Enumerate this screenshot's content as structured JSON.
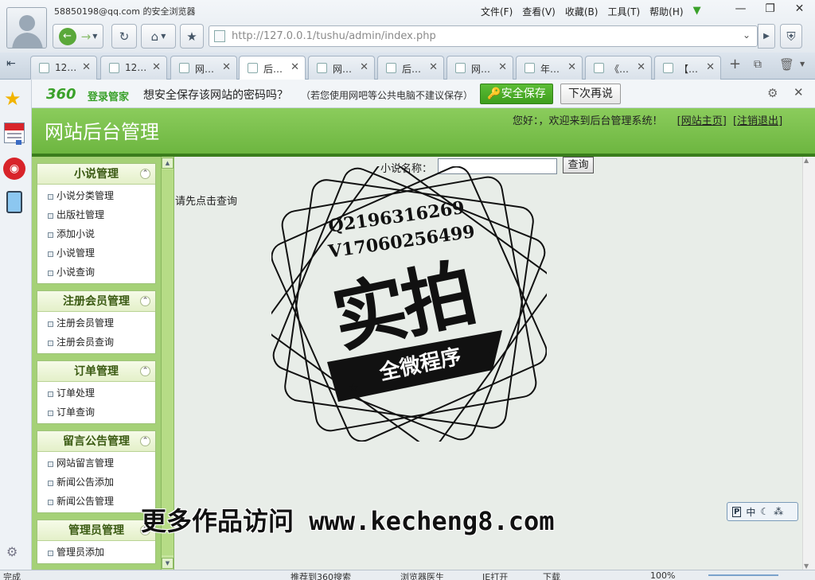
{
  "browser": {
    "account": "58850198@qq.com 的安全浏览器",
    "menus": [
      "文件(F)",
      "查看(V)",
      "收藏(B)",
      "工具(T)",
      "帮助(H)"
    ],
    "url": "http://127.0.0.1/tushu/admin/index.php",
    "tabs": [
      "12…",
      "12…",
      "网…",
      "后…",
      "网…",
      "后…",
      "网…",
      "年…",
      "《…",
      "【…"
    ],
    "active_tab": 3
  },
  "password_bar": {
    "brand": "360",
    "brand_suffix": "登录管家",
    "prompt": "想安全保存该网站的密码吗？",
    "note": "（若您使用网吧等公共电脑不建议保存）",
    "save_label": "安全保存",
    "later_label": "下次再说"
  },
  "header": {
    "title": "网站后台管理",
    "welcome": "您好：，欢迎来到后台管理系统！",
    "home_link": "网站主页",
    "logout_link": "注销退出"
  },
  "menu": [
    {
      "title": "小说管理",
      "items": [
        "小说分类管理",
        "出版社管理",
        "添加小说",
        "小说管理",
        "小说查询"
      ]
    },
    {
      "title": "注册会员管理",
      "items": [
        "注册会员管理",
        "注册会员查询"
      ]
    },
    {
      "title": "订单管理",
      "items": [
        "订单处理",
        "订单查询"
      ]
    },
    {
      "title": "留言公告管理",
      "items": [
        "网站留言管理",
        "新闻公告添加",
        "新闻公告管理"
      ]
    },
    {
      "title": "管理员管理",
      "items": [
        "管理员添加"
      ]
    }
  ],
  "search": {
    "label": "小说名称：",
    "value": "",
    "button": "查询"
  },
  "hint": "请先点击查询",
  "stamp": {
    "line1": "Q2196316269",
    "line2": "V17060256499",
    "big": "实拍",
    "ribbon": "全微程序"
  },
  "watermark": "更多作品访问 www.kecheng8.com",
  "ime": [
    "中"
  ],
  "status": {
    "left": "完成",
    "items": [
      "推荐到360搜索",
      "浏览器医生",
      "IE打开",
      "下载",
      "100%"
    ]
  },
  "colors": {
    "header_green": "#6db640",
    "save_button": "#3e9e1e",
    "menu_green": "#a5d177"
  }
}
